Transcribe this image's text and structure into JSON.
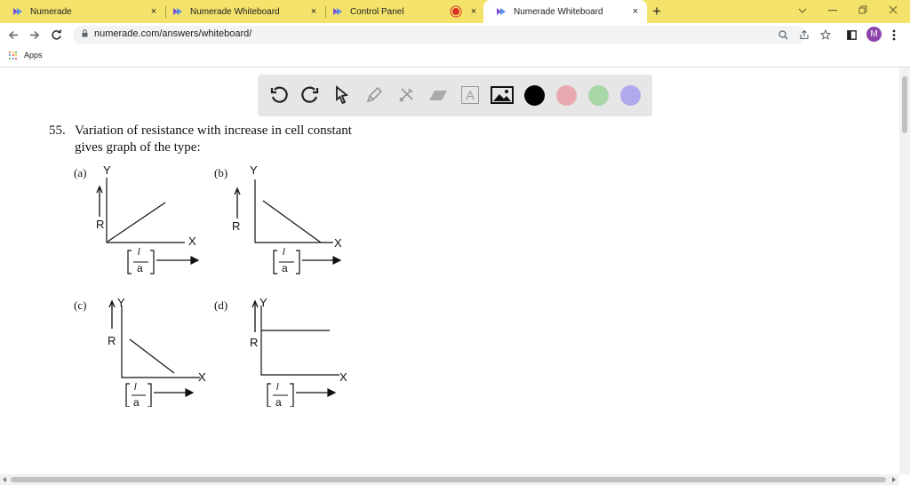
{
  "browser": {
    "tabs": [
      {
        "title": "Numerade",
        "close": "×"
      },
      {
        "title": "Numerade Whiteboard",
        "close": "×"
      },
      {
        "title": "Control Panel",
        "close": "×"
      },
      {
        "title": "Numerade Whiteboard",
        "close": "×"
      }
    ],
    "active_tab": 3,
    "new_tab": "+",
    "url": "numerade.com/answers/whiteboard/",
    "profile_initial": "M",
    "bookmarks": [
      {
        "label": "Apps"
      }
    ],
    "colors": {
      "tab_strip": "#f4e36a",
      "recording": "#d93025",
      "profile": "#8e44ad"
    }
  },
  "whiteboard": {
    "tools": [
      "undo-icon",
      "redo-icon",
      "pointer-icon",
      "pen-icon",
      "tools-icon",
      "eraser-icon",
      "text-icon",
      "image-icon"
    ],
    "text_tool_glyph": "A",
    "colors": [
      "#000000",
      "#e8a9ae",
      "#a8d8a8",
      "#b0aaec"
    ]
  },
  "question": {
    "number": "55.",
    "line1": "Variation of resistance with increase in cell constant",
    "line2": "gives graph of the type:",
    "options": [
      {
        "label": "(a)",
        "y_axis": "Y",
        "x_axis": "X",
        "r_label": "R",
        "frac_num": "l",
        "frac_den": "a"
      },
      {
        "label": "(b)",
        "y_axis": "Y",
        "x_axis": "X",
        "r_label": "R",
        "frac_num": "l",
        "frac_den": "a"
      },
      {
        "label": "(c)",
        "y_axis": "Y",
        "x_axis": "X",
        "r_label": "R",
        "frac_num": "l",
        "frac_den": "a"
      },
      {
        "label": "(d)",
        "y_axis": "Y",
        "x_axis": "X",
        "r_label": "R",
        "frac_num": "l",
        "frac_den": "a"
      }
    ]
  }
}
